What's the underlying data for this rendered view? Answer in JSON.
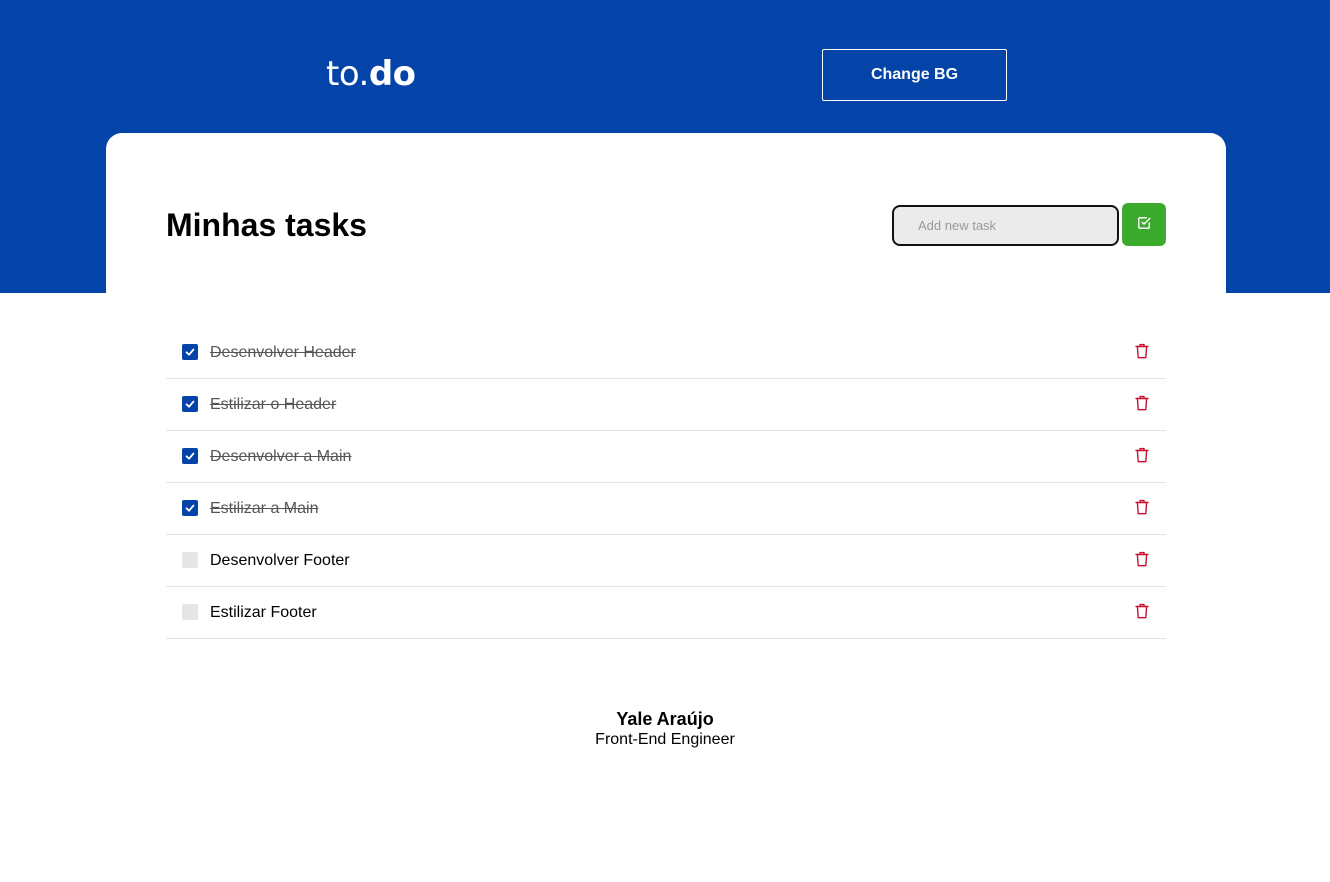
{
  "header": {
    "logo_light": "to.",
    "logo_bold": "do",
    "change_bg_label": "Change BG"
  },
  "main": {
    "title": "Minhas tasks",
    "input": {
      "value": "",
      "placeholder": "Add new task"
    },
    "add_button_icon": "check-square-icon"
  },
  "tasks": [
    {
      "label": "Desenvolver Header",
      "done": true
    },
    {
      "label": "Estilizar o Header",
      "done": true
    },
    {
      "label": "Desenvolver a Main",
      "done": true
    },
    {
      "label": "Estilizar a Main",
      "done": true
    },
    {
      "label": "Desenvolver Footer",
      "done": false
    },
    {
      "label": "Estilizar Footer",
      "done": false
    }
  ],
  "footer": {
    "name": "Yale Araújo",
    "role": "Front-End Engineer"
  },
  "colors": {
    "primary": "#0443a8",
    "success": "#3caa2c",
    "danger": "#c8102e",
    "unchecked": "#e6e6e6"
  }
}
